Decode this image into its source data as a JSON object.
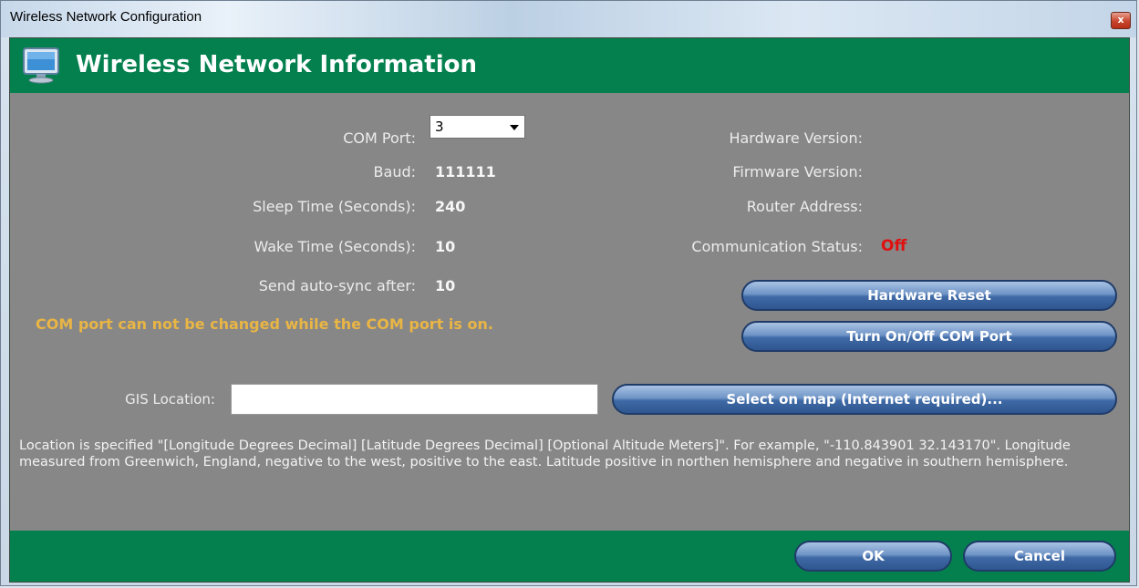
{
  "window": {
    "title": "Wireless Network Configuration",
    "close_glyph": "x"
  },
  "header": {
    "title": "Wireless Network Information",
    "icon": "monitor-icon"
  },
  "fields": {
    "com_port_label": "COM Port:",
    "com_port_value": "3",
    "baud_label": "Baud:",
    "baud_value": "111111",
    "sleep_label": "Sleep Time (Seconds):",
    "sleep_value": "240",
    "wake_label": "Wake Time (Seconds):",
    "wake_value": "10",
    "autosync_label": "Send auto-sync after:",
    "autosync_value": "10",
    "hw_version_label": "Hardware Version:",
    "fw_version_label": "Firmware Version:",
    "router_label": "Router Address:",
    "comm_status_label": "Communication Status:",
    "comm_status_value": "Off"
  },
  "warning": "COM port can not be changed while the COM port is on.",
  "buttons": {
    "hardware_reset": "Hardware Reset",
    "toggle_com": "Turn On/Off COM Port",
    "select_map": "Select on map (Internet required)...",
    "ok": "OK",
    "cancel": "Cancel"
  },
  "gis": {
    "label": "GIS Location:",
    "value": ""
  },
  "help_text": "Location is specified \"[Longitude Degrees Decimal] [Latitude Degrees Decimal] [Optional Altitude Meters]\". For example, \"-110.843901 32.143170\". Longitude measured from Greenwich, England, negative to the west, positive to the east. Latitude positive in northen hemisphere and negative in southern hemisphere.",
  "colors": {
    "header_green": "#03804e",
    "panel_gray": "#878787",
    "warning_yellow": "#e9b545",
    "status_red": "#e01010",
    "button_blue": "#3f6aa6"
  }
}
